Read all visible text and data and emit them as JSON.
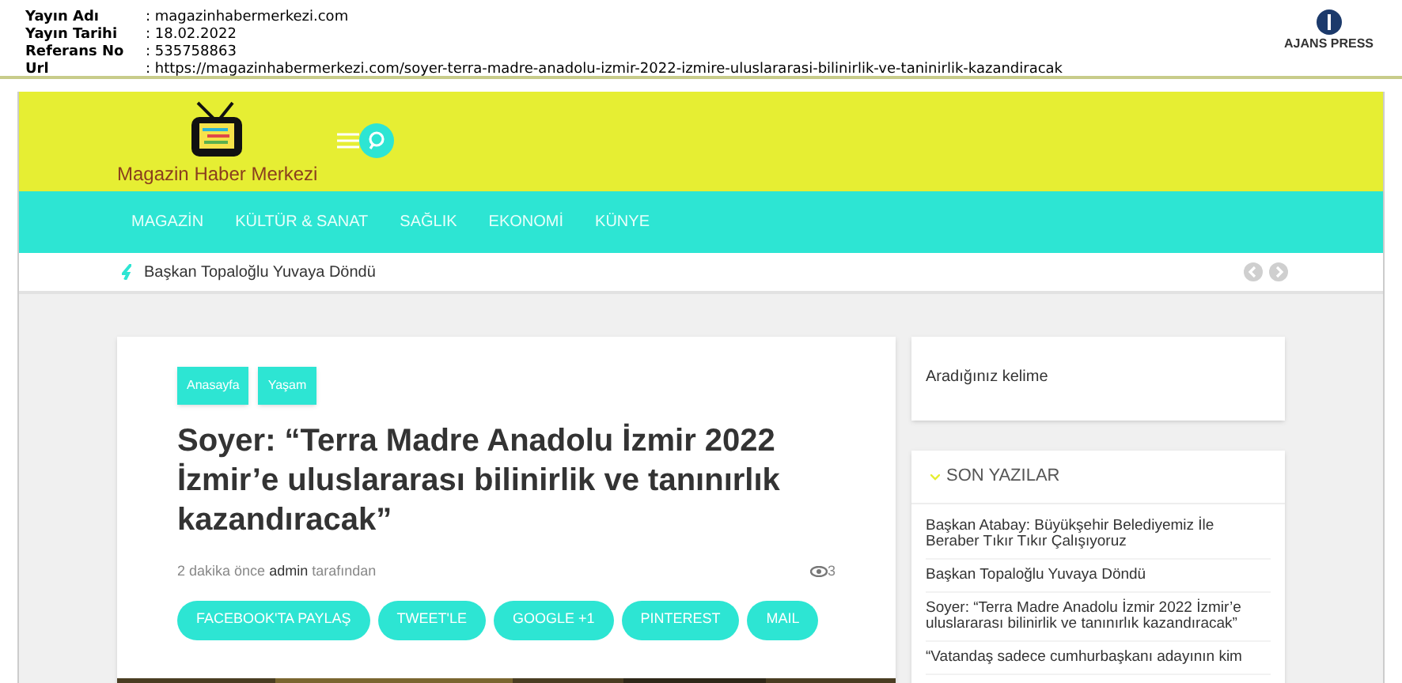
{
  "meta": [
    {
      "label": "Yayın Adı",
      "value": ": magazinhabermerkezi.com"
    },
    {
      "label": "Yayın Tarihi",
      "value": ": 18.02.2022"
    },
    {
      "label": "Referans No",
      "value": ": 535758863"
    },
    {
      "label": "Url",
      "value": ": https://magazinhabermerkezi.com/soyer-terra-madre-anadolu-izmir-2022-izmire-uluslararasi-bilinirlik-ve-taninirlik-kazandiracak"
    }
  ],
  "agency": "AJANS PRESS",
  "site": {
    "name": "Magazin Haber Merkezi"
  },
  "nav": [
    "MAGAZİN",
    "KÜLTÜR & SANAT",
    "SAĞLIK",
    "EKONOMİ",
    "KÜNYE"
  ],
  "ticker": "Başkan Topaloğlu Yuvaya Döndü",
  "article": {
    "tags": [
      "Anasayfa",
      "Yaşam"
    ],
    "title": "Soyer: “Terra Madre Anadolu İzmir 2022 İzmir’e uluslararası bilinirlik ve tanınırlık kazandıracak”",
    "time": "2 dakika önce",
    "author": "admin",
    "by": "tarafından",
    "views": "3",
    "share": [
      "FACEBOOK'TA PAYLAŞ",
      "TWEET'LE",
      "GOOGLE +1",
      "PINTEREST",
      "MAIL"
    ]
  },
  "sidebar": {
    "search_placeholder": "Aradığınız kelime",
    "recent_title": "SON YAZILAR",
    "recent": [
      "Başkan Atabay: Büyükşehir Belediyemiz İle Beraber Tıkır Tıkır Çalışıyoruz",
      "Başkan Topaloğlu Yuvaya Döndü",
      "Soyer: “Terra Madre Anadolu İzmir 2022 İzmir’e uluslararası bilinirlik ve tanınırlık kazandıracak”",
      "“Vatandaş sadece cumhurbaşkanı adayının kim"
    ]
  }
}
